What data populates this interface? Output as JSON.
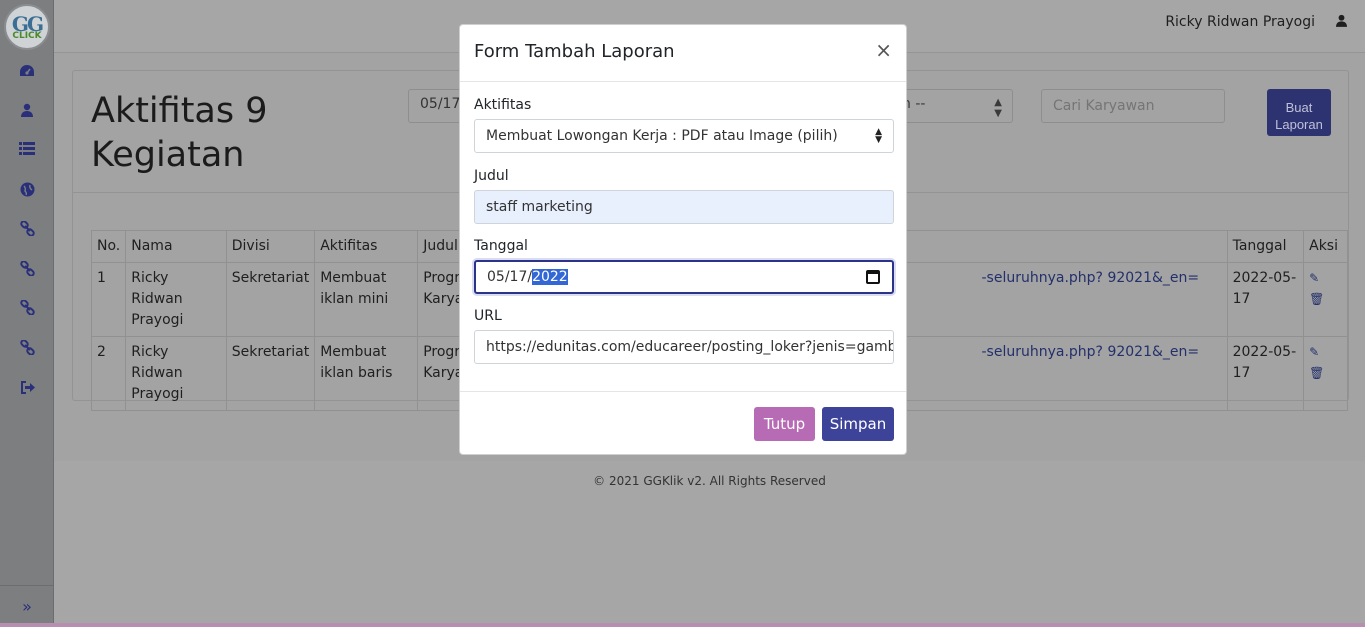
{
  "app": {
    "logo_top": "GG",
    "logo_bottom": "CLICK",
    "user_name": "Ricky Ridwan Prayogi"
  },
  "sidebar": {
    "icons": [
      "dashboard-icon",
      "user-icon",
      "list-icon",
      "globe-icon",
      "link-icon",
      "link-icon",
      "link-icon",
      "link-icon",
      "logout-icon"
    ],
    "toggle": "»"
  },
  "page": {
    "title": "Aktifitas 9 Kegiatan",
    "date_filter": "05/17",
    "divisi_select": "n --",
    "search_placeholder": "Cari Karyawan",
    "buat_laporan": "Buat Laporan"
  },
  "table": {
    "headers": [
      "No.",
      "Nama",
      "Divisi",
      "Aktifitas",
      "Judul",
      "",
      "Tanggal",
      "Aksi"
    ],
    "rows": [
      {
        "no": "1",
        "nama": "Ricky Ridwan Prayogi",
        "divisi": "Sekretariat",
        "aktifitas": "Membuat iklan mini",
        "judul": "Progran Karyaw",
        "url": "-seluruhnya.php? 92021&_en=",
        "tanggal": "2022-05-17"
      },
      {
        "no": "2",
        "nama": "Ricky Ridwan Prayogi",
        "divisi": "Sekretariat",
        "aktifitas": "Membuat iklan baris",
        "judul": "Progran Karyaw",
        "url": "-seluruhnya.php? 92021&_en=",
        "tanggal": "2022-05-17"
      }
    ]
  },
  "footer": {
    "text": "© 2021 GGKlik v2. All Rights Reserved"
  },
  "modal": {
    "title": "Form Tambah Laporan",
    "close": "×",
    "aktifitas_label": "Aktifitas",
    "aktifitas_value": "Membuat Lowongan Kerja : PDF atau Image (pilih)",
    "judul_label": "Judul",
    "judul_value": "staff marketing",
    "tanggal_label": "Tanggal",
    "tanggal_prefix": "05/17/",
    "tanggal_year": "2022",
    "url_label": "URL",
    "url_value": "https://edunitas.com/educareer/posting_loker?jenis=gambar",
    "btn_tutup": "Tutup",
    "btn_simpan": "Simpan"
  }
}
